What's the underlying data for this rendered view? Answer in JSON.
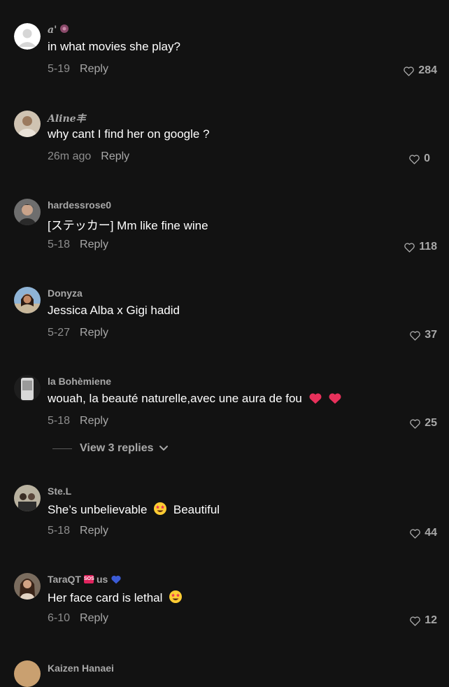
{
  "comments": [
    {
      "username": "a'",
      "text": "in what movies she play?",
      "time": "5-19",
      "reply": "Reply",
      "likes": "284"
    },
    {
      "username": "Aline丰",
      "text": "why cant I find her on google ?",
      "time": "26m ago",
      "reply": "Reply",
      "likes": "0"
    },
    {
      "username": "hardessrose0",
      "text": "[ステッカー] Mm like fine wine",
      "time": "5-18",
      "reply": "Reply",
      "likes": "118"
    },
    {
      "username": "Donyza",
      "text": "Jessica Alba x Gigi hadid",
      "time": "5-27",
      "reply": "Reply",
      "likes": "37"
    },
    {
      "username": "la Bohèmiene",
      "text": "wouah, la beauté naturelle,avec une aura de fou",
      "time": "5-18",
      "reply": "Reply",
      "likes": "25"
    },
    {
      "username": "Ste.L",
      "text": "She’s unbelievable",
      "text_after": "Beautiful",
      "time": "5-18",
      "reply": "Reply",
      "likes": "44"
    },
    {
      "username": "TaraQT",
      "username_suffix": "us",
      "text": "Her face card is lethal",
      "time": "6-10",
      "reply": "Reply",
      "likes": "12"
    },
    {
      "username": "Kaizen Hanaei"
    }
  ],
  "view_replies": "View 3 replies",
  "colors": {
    "background": "#121212",
    "text_primary": "#ffffff",
    "text_secondary": "#a8a8a8",
    "heart_emoji": "#e8315b",
    "star_eyes_emoji": "#ffcc33"
  }
}
